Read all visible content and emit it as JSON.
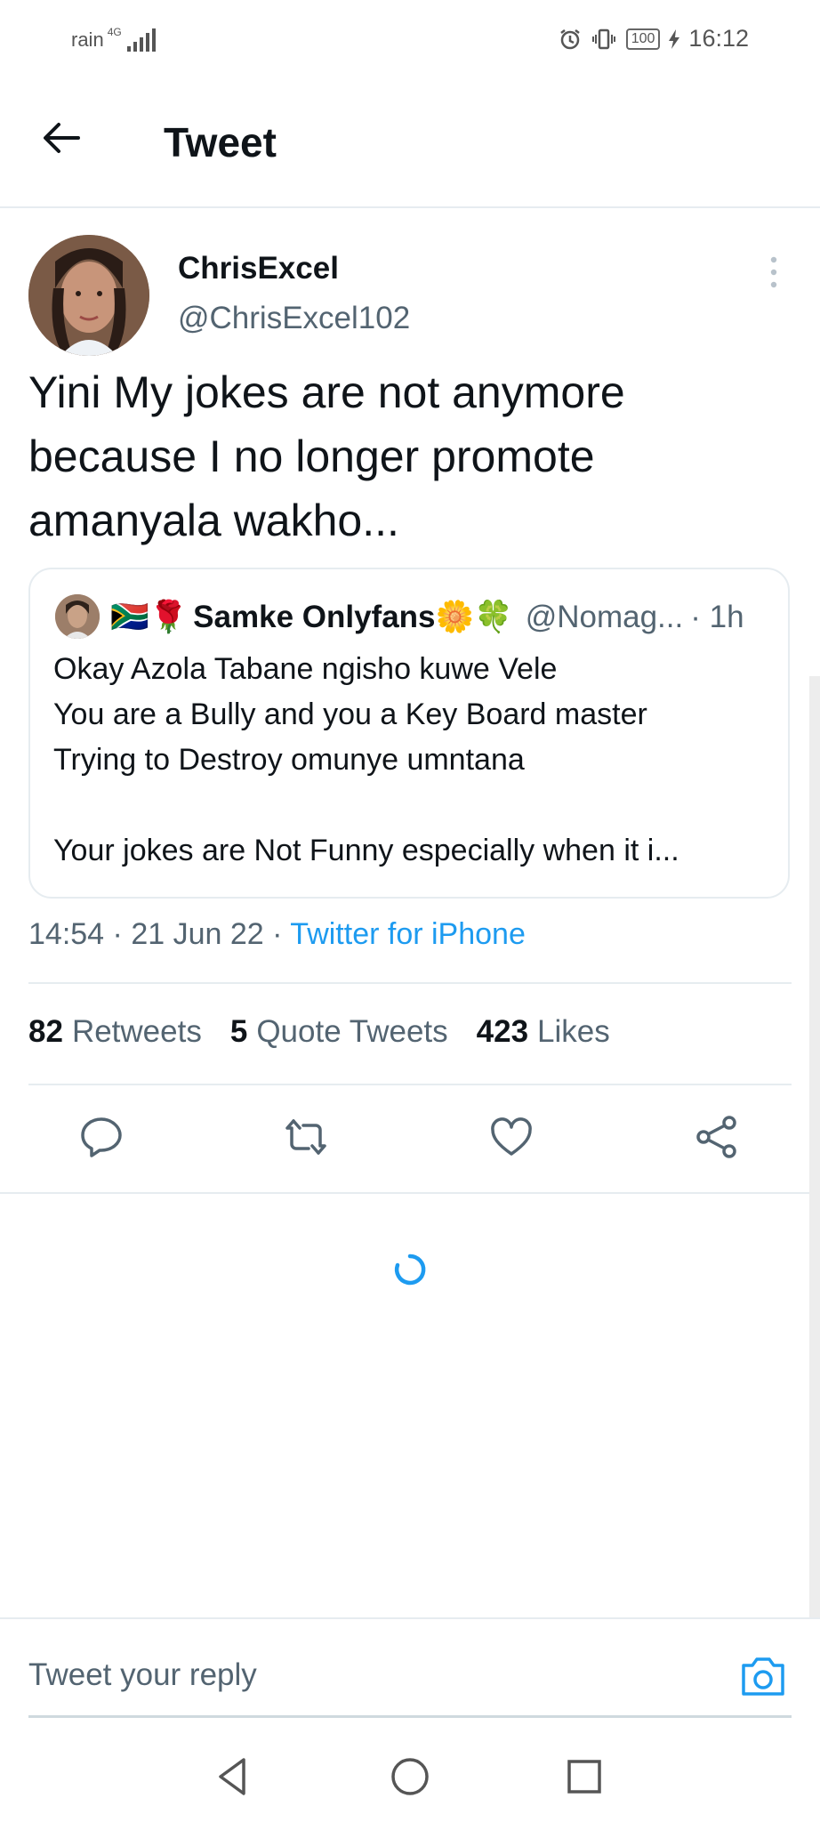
{
  "status_bar": {
    "carrier": "rain",
    "network_type": "4G",
    "battery": "100",
    "time": "16:12"
  },
  "header": {
    "title": "Tweet",
    "back_icon": "arrow-left-icon"
  },
  "tweet": {
    "author_name": "ChrisExcel",
    "author_handle": "@ChrisExcel102",
    "text": "Yini My jokes are not anymore\nbecause I no longer promote\namanyala wakho...",
    "quote": {
      "emoji_before": "🇿🇦🌹",
      "name": "Samke Onlyfans",
      "emoji_after": "🌼🍀",
      "handle": "@Nomag...",
      "time": "· 1h",
      "text": "Okay Azola Tabane ngisho kuwe Vele\nYou are a Bully and you a Key Board master\nTrying to Destroy omunye umntana\n\nYour jokes are Not Funny especially when it i..."
    },
    "time": "14:54",
    "date": "21 Jun 22",
    "source": "Twitter for iPhone",
    "stats": {
      "retweets_count": "82",
      "retweets_label": "Retweets",
      "quotes_count": "5",
      "quotes_label": "Quote Tweets",
      "likes_count": "423",
      "likes_label": "Likes"
    }
  },
  "reply": {
    "placeholder": "Tweet your reply"
  },
  "colors": {
    "accent": "#1d9bf0",
    "secondary_text": "#536471",
    "divider": "#e6ecf0"
  }
}
